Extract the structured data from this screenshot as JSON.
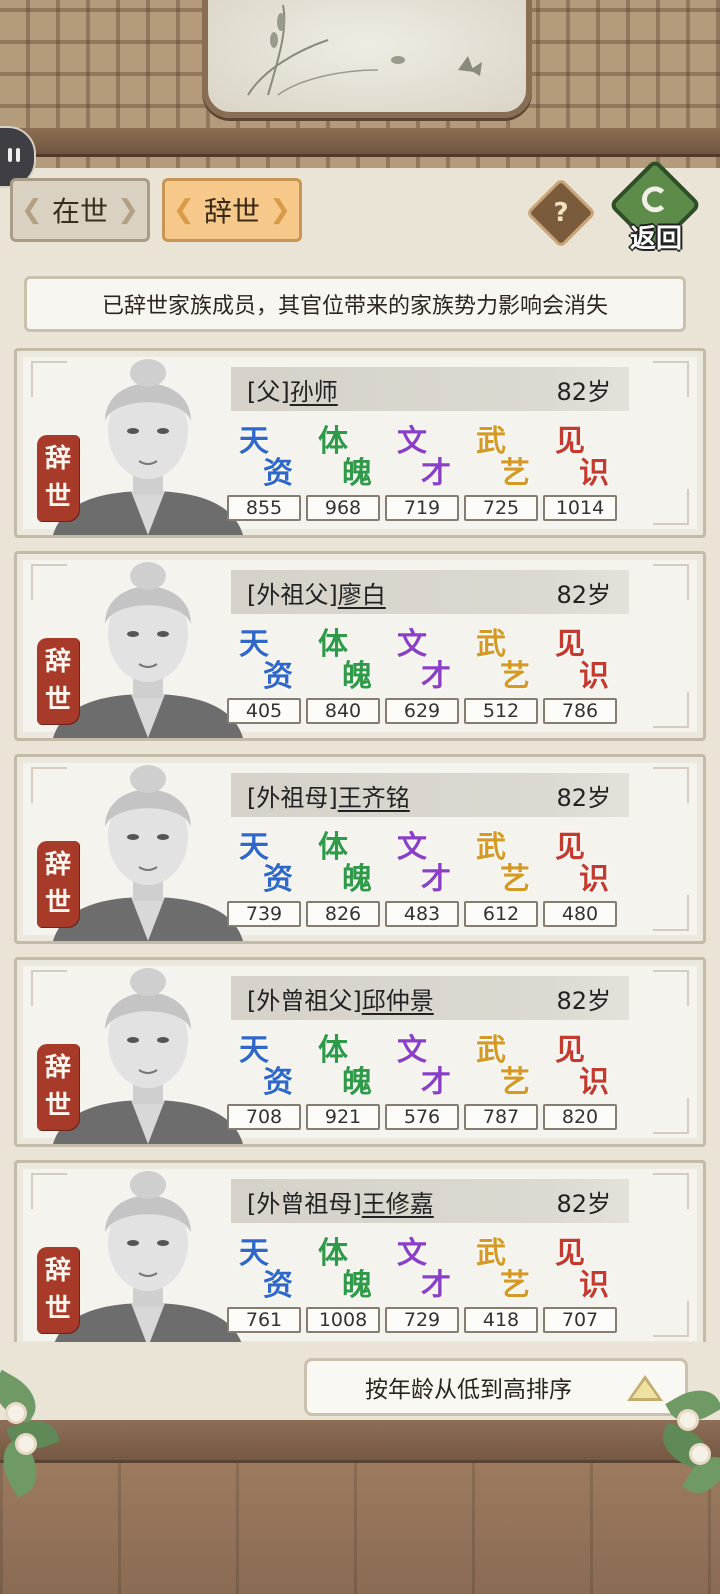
{
  "tabs": {
    "alive_label": "在世",
    "deceased_label": "辞世"
  },
  "help_label": "?",
  "back_label": "返回",
  "notice_text": "已辞世家族成员，其官位带来的家族势力影响会消失",
  "stat_labels": [
    {
      "top": "天",
      "bottom": "资",
      "color": "#2f68c9"
    },
    {
      "top": "体",
      "bottom": "魄",
      "color": "#2f9a48"
    },
    {
      "top": "文",
      "bottom": "才",
      "color": "#8b3fc7"
    },
    {
      "top": "武",
      "bottom": "艺",
      "color": "#d59a26"
    },
    {
      "top": "见",
      "bottom": "识",
      "color": "#c33a2e"
    }
  ],
  "deceased_stamp": "辞世",
  "members": [
    {
      "relation": "[父]",
      "name": "孙师",
      "age": "82岁",
      "stats": [
        "855",
        "968",
        "719",
        "725",
        "1014"
      ]
    },
    {
      "relation": "[外祖父]",
      "name": "廖白",
      "age": "82岁",
      "stats": [
        "405",
        "840",
        "629",
        "512",
        "786"
      ]
    },
    {
      "relation": "[外祖母]",
      "name": "王齐铭",
      "age": "82岁",
      "stats": [
        "739",
        "826",
        "483",
        "612",
        "480"
      ]
    },
    {
      "relation": "[外曾祖父]",
      "name": "邱仲景",
      "age": "82岁",
      "stats": [
        "708",
        "921",
        "576",
        "787",
        "820"
      ]
    },
    {
      "relation": "[外曾祖母]",
      "name": "王修嘉",
      "age": "82岁",
      "stats": [
        "761",
        "1008",
        "729",
        "418",
        "707"
      ]
    }
  ],
  "sort_label": "按年龄从低到高排序"
}
